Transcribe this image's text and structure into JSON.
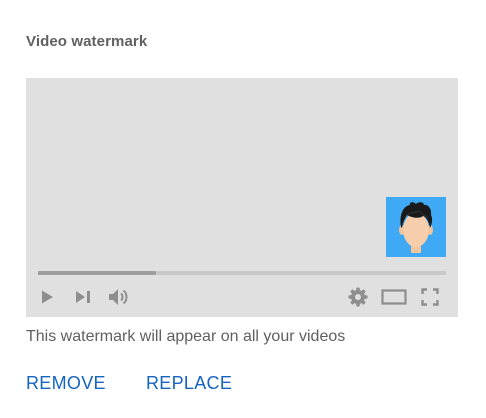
{
  "section": {
    "title": "Video watermark"
  },
  "player": {
    "progress_fraction": 0.29,
    "controls": {
      "play_icon": "play-icon",
      "next_icon": "skip-next-icon",
      "volume_icon": "volume-icon",
      "settings_icon": "gear-icon",
      "theater_icon": "theater-mode-icon",
      "fullscreen_icon": "fullscreen-icon"
    },
    "watermark_icon": "avatar-face-icon"
  },
  "caption": "This watermark will appear on all your videos",
  "actions": {
    "remove_label": "REMOVE",
    "replace_label": "REPLACE"
  },
  "colors": {
    "accent": "#1565c0",
    "preview_bg": "#e0e0e0",
    "watermark_bg": "#3fa9f5",
    "control_icons": "#8e8e8e"
  }
}
